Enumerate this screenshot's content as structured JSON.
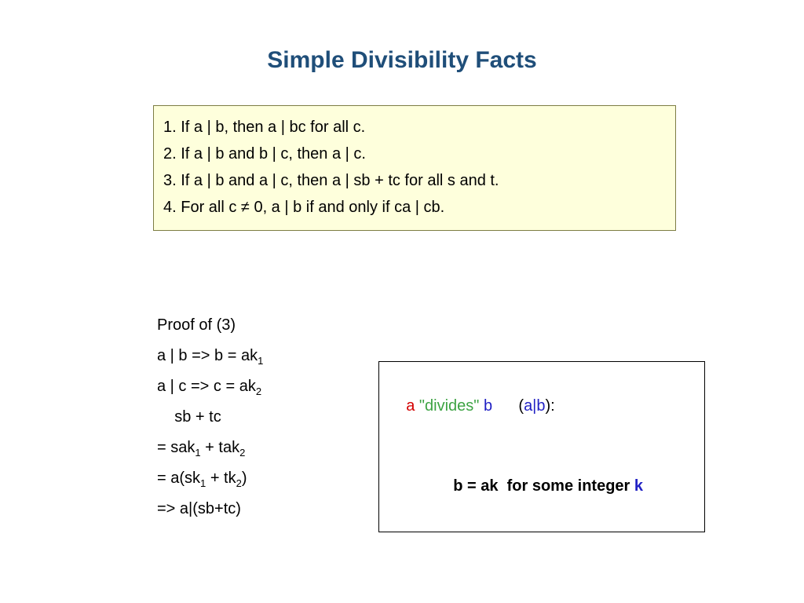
{
  "title": "Simple Divisibility Facts",
  "facts": {
    "f1": "1. If a | b, then a | bc for all c.",
    "f2": "2. If a | b and b | c, then a | c.",
    "f3": "3. If a | b and a | c, then a | sb + tc for all s and t.",
    "f4": "4. For all c ≠ 0, a | b if and only if ca | cb."
  },
  "proof": {
    "heading": "Proof of (3)",
    "l1a": "a | b   =>   b = ak",
    "l1sub": "1",
    "l2a": "a | c   =>   c = ak",
    "l2sub": "2",
    "l3": "    sb + tc",
    "l4a": "=  sak",
    "l4s1": "1",
    "l4b": " + tak",
    "l4s2": "2",
    "l5a": "=  a(sk",
    "l5s1": "1",
    "l5b": " + tk",
    "l5s2": "2",
    "l5c": ")",
    "l6": "=>  a|(sb+tc)"
  },
  "def": {
    "a": "a",
    "divides": " \"divides\" ",
    "b": "b",
    "open": "      (",
    "ab": "a|b",
    "close": "):",
    "eq_prefix": "b = ak",
    "eq_mid": "  for some integer ",
    "eq_k": "k"
  }
}
